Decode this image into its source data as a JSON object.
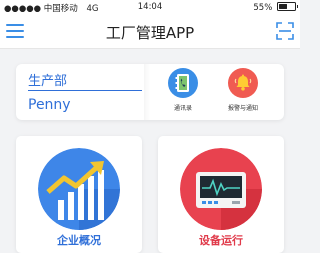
{
  "status_bar": {
    "carrier": "●●●●● 中国移动",
    "network": "4G",
    "time": "14:04",
    "battery": "55%",
    "battery_level": 0.55
  },
  "nav": {
    "title": "工厂管理APP",
    "menu_icon": "hamburger-icon",
    "scan_icon": "scan-icon"
  },
  "profile": {
    "department": "生产部",
    "user": "Penny"
  },
  "shortcuts": [
    {
      "label": "通讯录",
      "icon": "contacts-phone-icon",
      "color": "#3a8ee6"
    },
    {
      "label": "报警与通知",
      "icon": "alarm-bell-icon",
      "color": "#f05b52"
    }
  ],
  "tiles": [
    {
      "label": "企业概况",
      "icon": "bar-chart-growth-icon",
      "label_color": "#2f6fd8",
      "circle_color": "#3e86e8"
    },
    {
      "label": "设备运行",
      "icon": "monitor-heartbeat-icon",
      "label_color": "#e03a4a",
      "circle_color": "#e8424f"
    }
  ],
  "colors": {
    "accent_blue": "#2f6fd8",
    "accent_red": "#e03a4a",
    "background": "#f2f3f5"
  }
}
